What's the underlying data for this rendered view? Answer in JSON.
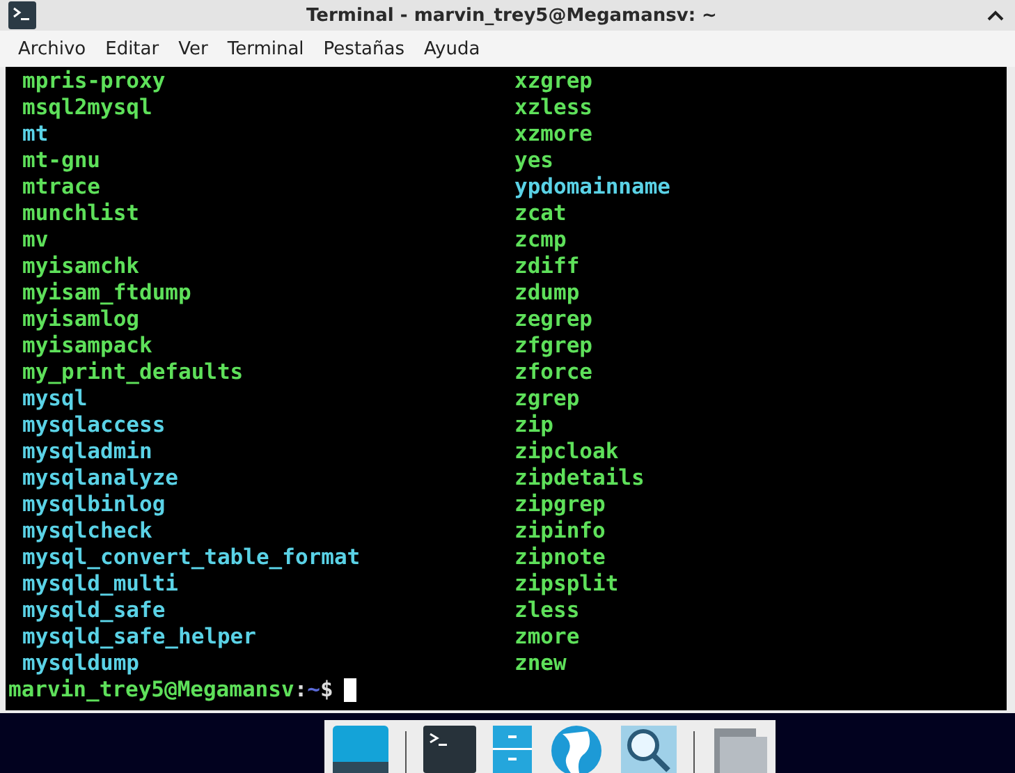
{
  "window": {
    "title": "Terminal - marvin_trey5@Megamansv: ~"
  },
  "menu": [
    "Archivo",
    "Editar",
    "Ver",
    "Terminal",
    "Pestañas",
    "Ayuda"
  ],
  "columns": [
    [
      {
        "name": "mpris-proxy",
        "kind": "executable"
      },
      {
        "name": "msql2mysql",
        "kind": "executable"
      },
      {
        "name": "mt",
        "kind": "symlink"
      },
      {
        "name": "mt-gnu",
        "kind": "executable"
      },
      {
        "name": "mtrace",
        "kind": "executable"
      },
      {
        "name": "munchlist",
        "kind": "executable"
      },
      {
        "name": "mv",
        "kind": "executable"
      },
      {
        "name": "myisamchk",
        "kind": "executable"
      },
      {
        "name": "myisam_ftdump",
        "kind": "executable"
      },
      {
        "name": "myisamlog",
        "kind": "executable"
      },
      {
        "name": "myisampack",
        "kind": "executable"
      },
      {
        "name": "my_print_defaults",
        "kind": "executable"
      },
      {
        "name": "mysql",
        "kind": "symlink"
      },
      {
        "name": "mysqlaccess",
        "kind": "symlink"
      },
      {
        "name": "mysqladmin",
        "kind": "symlink"
      },
      {
        "name": "mysqlanalyze",
        "kind": "symlink"
      },
      {
        "name": "mysqlbinlog",
        "kind": "symlink"
      },
      {
        "name": "mysqlcheck",
        "kind": "symlink"
      },
      {
        "name": "mysql_convert_table_format",
        "kind": "symlink"
      },
      {
        "name": "mysqld_multi",
        "kind": "symlink"
      },
      {
        "name": "mysqld_safe",
        "kind": "symlink"
      },
      {
        "name": "mysqld_safe_helper",
        "kind": "symlink"
      },
      {
        "name": "mysqldump",
        "kind": "symlink"
      }
    ],
    [
      {
        "name": "xzgrep",
        "kind": "executable"
      },
      {
        "name": "xzless",
        "kind": "executable"
      },
      {
        "name": "xzmore",
        "kind": "executable"
      },
      {
        "name": "yes",
        "kind": "executable"
      },
      {
        "name": "ypdomainname",
        "kind": "symlink"
      },
      {
        "name": "zcat",
        "kind": "executable"
      },
      {
        "name": "zcmp",
        "kind": "executable"
      },
      {
        "name": "zdiff",
        "kind": "executable"
      },
      {
        "name": "zdump",
        "kind": "executable"
      },
      {
        "name": "zegrep",
        "kind": "executable"
      },
      {
        "name": "zfgrep",
        "kind": "executable"
      },
      {
        "name": "zforce",
        "kind": "executable"
      },
      {
        "name": "zgrep",
        "kind": "executable"
      },
      {
        "name": "zip",
        "kind": "executable"
      },
      {
        "name": "zipcloak",
        "kind": "executable"
      },
      {
        "name": "zipdetails",
        "kind": "executable"
      },
      {
        "name": "zipgrep",
        "kind": "executable"
      },
      {
        "name": "zipinfo",
        "kind": "executable"
      },
      {
        "name": "zipnote",
        "kind": "executable"
      },
      {
        "name": "zipsplit",
        "kind": "executable"
      },
      {
        "name": "zless",
        "kind": "executable"
      },
      {
        "name": "zmore",
        "kind": "executable"
      },
      {
        "name": "znew",
        "kind": "executable"
      }
    ]
  ],
  "prompt": {
    "user_host": "marvin_trey5@Megamansv",
    "separator": ":",
    "path": "~",
    "symbol": "$"
  }
}
